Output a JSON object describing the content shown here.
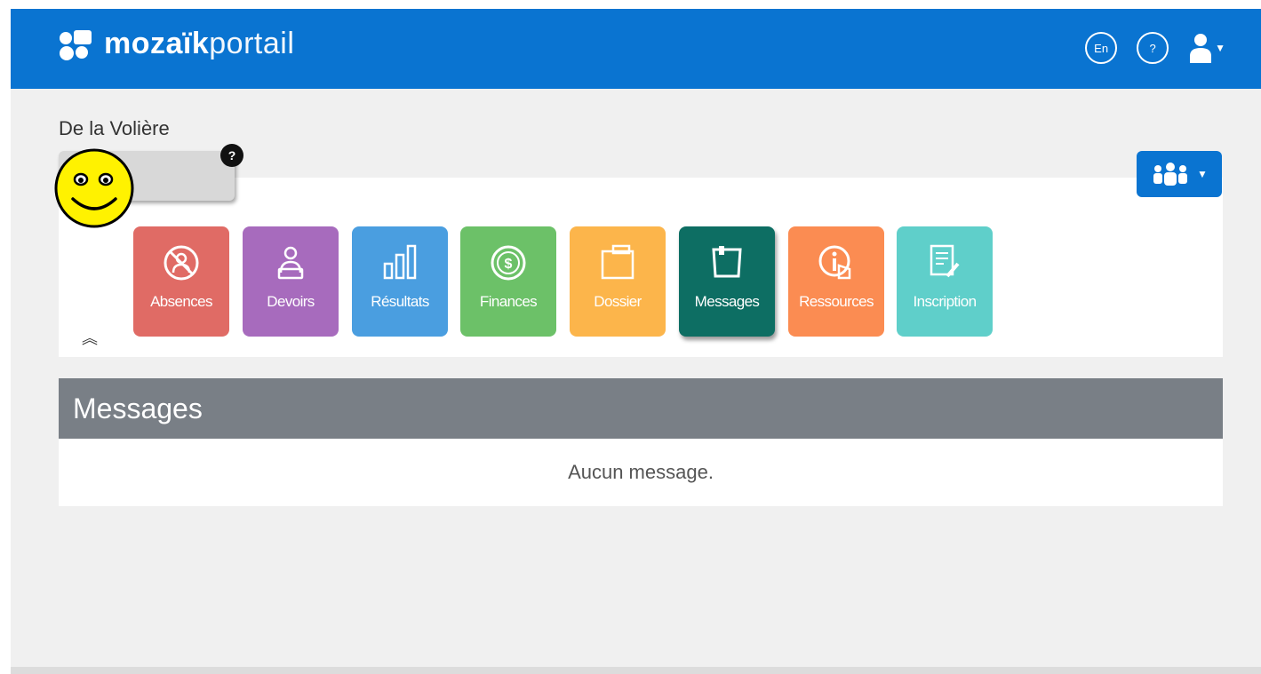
{
  "header": {
    "logo_bold": "mozaïk",
    "logo_light": "portail",
    "lang_button": "En",
    "help_button": "?"
  },
  "school_name": "De la Volière",
  "help_badge": "?",
  "apps": [
    {
      "label": "Absences",
      "icon": "absence-icon",
      "color": "#e06b65"
    },
    {
      "label": "Devoirs",
      "icon": "homework-icon",
      "color": "#a76bbd"
    },
    {
      "label": "Résultats",
      "icon": "bar-chart-icon",
      "color": "#4a9ee0"
    },
    {
      "label": "Finances",
      "icon": "dollar-coin-icon",
      "color": "#6cc168"
    },
    {
      "label": "Dossier",
      "icon": "folder-icon",
      "color": "#fcb54b"
    },
    {
      "label": "Messages",
      "icon": "message-icon",
      "color": "#0d6e63"
    },
    {
      "label": "Ressources",
      "icon": "info-hand-icon",
      "color": "#fb8c52"
    },
    {
      "label": "Inscription",
      "icon": "form-pencil-icon",
      "color": "#5fcfca"
    }
  ],
  "messages": {
    "title": "Messages",
    "empty_text": "Aucun message."
  },
  "colors": {
    "brand": "#0a74d1",
    "section_header": "#797f86"
  }
}
